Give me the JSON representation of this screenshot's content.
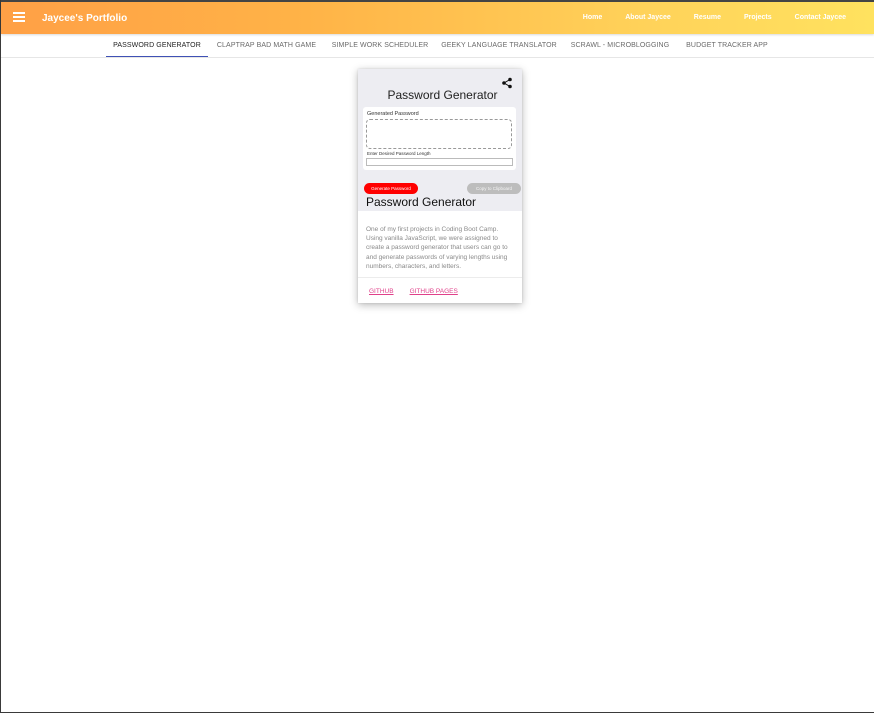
{
  "header": {
    "brand": "Jaycee's Portfolio",
    "menu_icon": "hamburger-menu-icon",
    "nav": [
      "Home",
      "About Jaycee",
      "Resume",
      "Projects",
      "Contact Jaycee"
    ]
  },
  "tabs": [
    {
      "label": "PASSWORD GENERATOR",
      "active": true
    },
    {
      "label": "CLAPTRAP BAD MATH GAME",
      "active": false
    },
    {
      "label": "SIMPLE WORK SCHEDULER",
      "active": false
    },
    {
      "label": "GEEKY LANGUAGE TRANSLATOR",
      "active": false
    },
    {
      "label": "SCRAWL - MICROBLOGGING",
      "active": false
    },
    {
      "label": "BUDGET TRACKER APP",
      "active": false
    }
  ],
  "card": {
    "share_icon": "share-icon",
    "preview": {
      "title": "Password Generator",
      "generated_label": "Generated Password",
      "length_label": "Enter Desired Password Length",
      "generate_button": "Generate Password",
      "copy_button": "Copy to Clipboard"
    },
    "title": "Password Generator",
    "description": "One of my first projects in Coding Boot Camp. Using vanilla JavaScript, we were assigned to create a password generator that users can go to and generate passwords of varying lengths using numbers, characters, and letters.",
    "links": [
      "GITHUB",
      "GITHUB PAGES"
    ]
  },
  "colors": {
    "accent_tab": "#3f51b5",
    "link": "#e0408a",
    "generate_button": "#ff0000"
  }
}
